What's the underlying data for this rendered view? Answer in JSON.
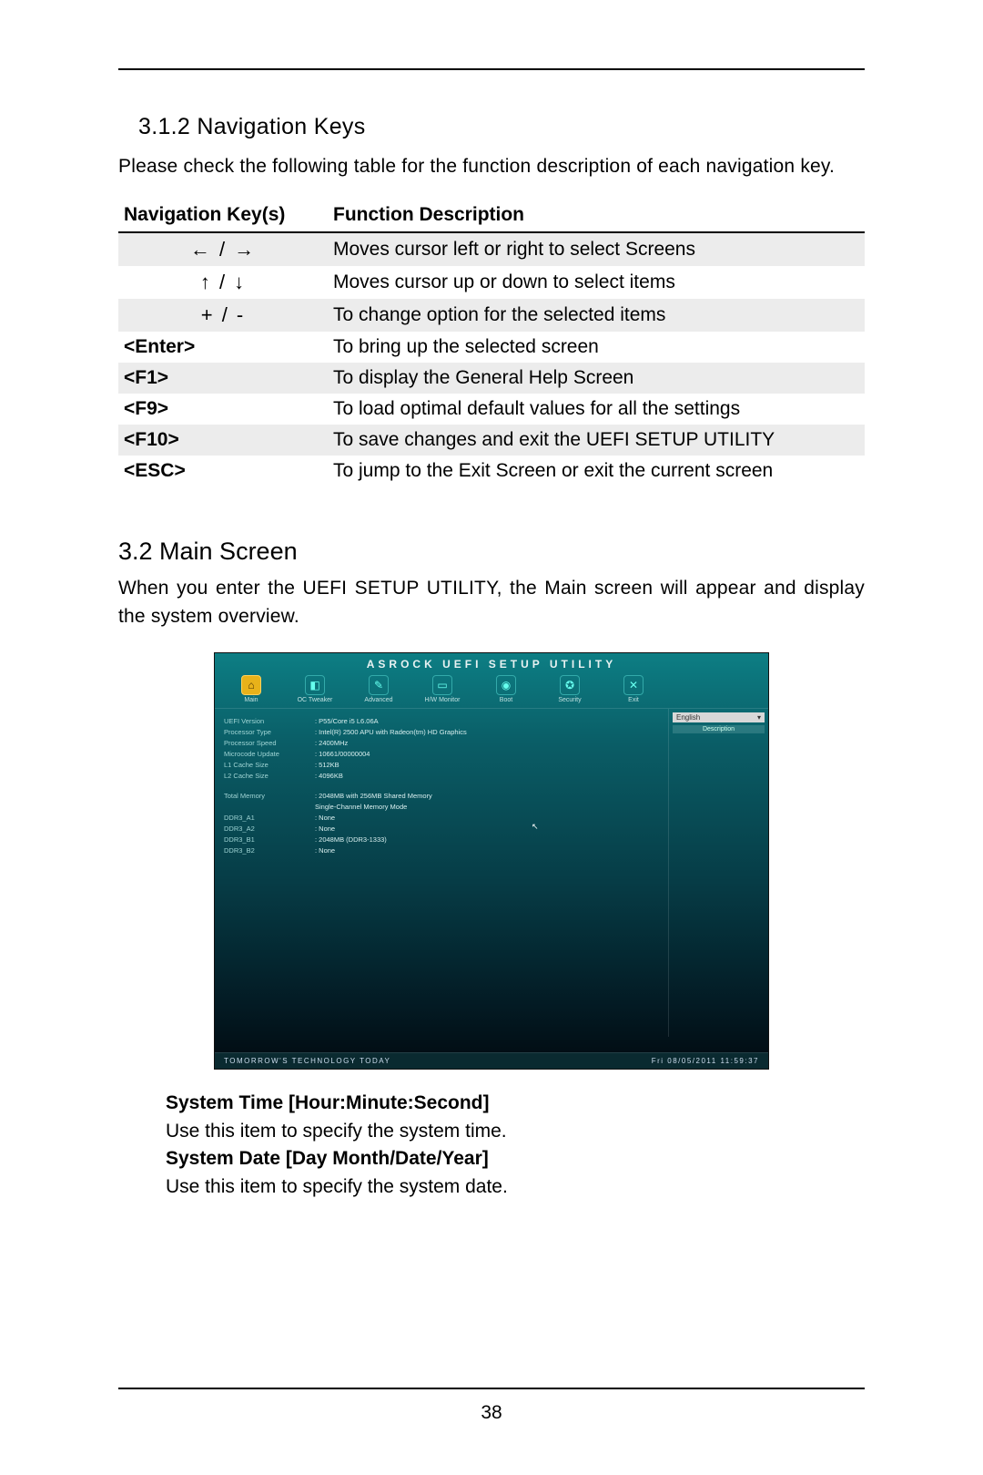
{
  "section312_heading": "3.1.2   Navigation Keys",
  "section312_intro": "Please check the following table for the function description of each navigation key.",
  "nav_table": {
    "col1": "Navigation Key(s)",
    "col2": "Function Description",
    "rows": [
      {
        "key_glyph": "←  /  →",
        "desc": "Moves cursor left or right to select Screens",
        "shaded": true,
        "center": true
      },
      {
        "key_glyph": "↑  /  ↓",
        "desc": "Moves cursor up or down to select items",
        "shaded": false,
        "center": true
      },
      {
        "key_glyph": "+  /  -",
        "desc": "To change option for the selected items",
        "shaded": true,
        "center": true
      },
      {
        "key_glyph": "<Enter>",
        "desc": "To bring up the selected screen",
        "shaded": false,
        "bold": true
      },
      {
        "key_glyph": "<F1>",
        "desc": "To display the General Help Screen",
        "shaded": true,
        "bold": true
      },
      {
        "key_glyph": "<F9>",
        "desc": "To load optimal default values for all the settings",
        "shaded": false,
        "bold": true
      },
      {
        "key_glyph": "<F10>",
        "desc": "To save changes and exit the UEFI SETUP UTILITY",
        "shaded": true,
        "bold": true
      },
      {
        "key_glyph": "<ESC>",
        "desc": "To jump to the Exit Screen or exit the current screen",
        "shaded": false,
        "bold": true
      }
    ]
  },
  "section32_heading": "3.2  Main Screen",
  "section32_intro": "When you enter the UEFI SETUP UTILITY, the Main screen will appear and display the system overview.",
  "bios": {
    "title": "ASROCK UEFI SETUP UTILITY",
    "tabs": [
      {
        "label": "Main",
        "glyph": "⌂",
        "active": true
      },
      {
        "label": "OC Tweaker",
        "glyph": "◧"
      },
      {
        "label": "Advanced",
        "glyph": "✎"
      },
      {
        "label": "H/W Monitor",
        "glyph": "▭"
      },
      {
        "label": "Boot",
        "glyph": "◉"
      },
      {
        "label": "Security",
        "glyph": "✪"
      },
      {
        "label": "Exit",
        "glyph": "✕"
      }
    ],
    "lang_label": "English",
    "lang_arrow": "▾",
    "desc_label": "Description",
    "info": [
      {
        "lbl": "UEFI Version",
        "val": ": P55/Core i5 L6.06A"
      },
      {
        "lbl": "Processor Type",
        "val": ": Intel(R) 2500 APU with Radeon(tm) HD Graphics"
      },
      {
        "lbl": "Processor Speed",
        "val": ": 2400MHz"
      },
      {
        "lbl": "Microcode Update",
        "val": ": 10661/00000004"
      },
      {
        "lbl": "L1 Cache Size",
        "val": ": 512KB"
      },
      {
        "lbl": "L2 Cache Size",
        "val": ": 4096KB"
      }
    ],
    "mem": [
      {
        "lbl": "Total Memory",
        "val": ": 2048MB with 256MB Shared Memory"
      },
      {
        "lbl": "",
        "val": "  Single-Channel Memory Mode"
      },
      {
        "lbl": "DDR3_A1",
        "val": ": None"
      },
      {
        "lbl": "DDR3_A2",
        "val": ": None"
      },
      {
        "lbl": "DDR3_B1",
        "val": ": 2048MB (DDR3-1333)"
      },
      {
        "lbl": "DDR3_B2",
        "val": ": None"
      }
    ],
    "footer_left": "TOMORROW'S TECHNOLOGY TODAY",
    "footer_right": "Fri 08/05/2011  11:59:37"
  },
  "defs": {
    "systime_lbl": "System Time [Hour:Minute:Second]",
    "systime_txt": "Use this item to specify the system time.",
    "sysdate_lbl": "System Date [Day Month/Date/Year]",
    "sysdate_txt": "Use this item to specify the system date."
  },
  "page_number": "38"
}
